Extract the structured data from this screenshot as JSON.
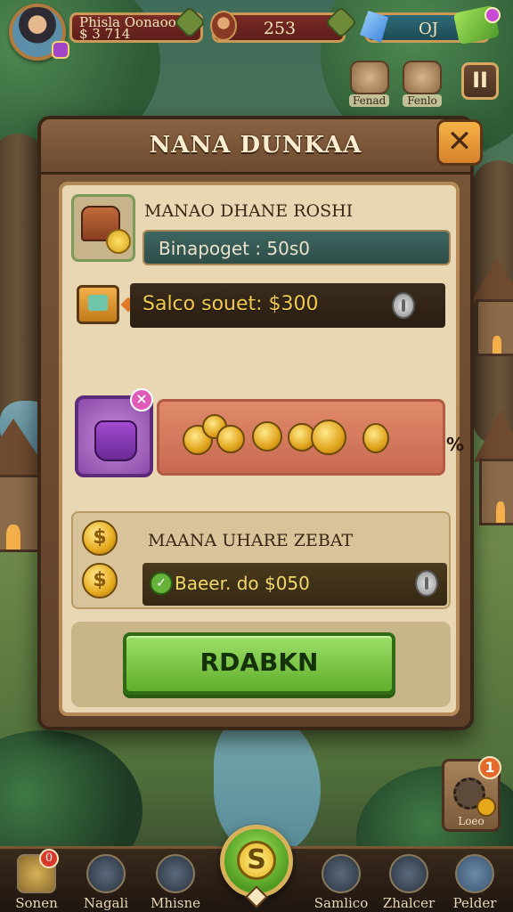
{
  "hud": {
    "player_name": "Phisla Oonaoo",
    "player_sub": "$ 3 714",
    "coins": "253",
    "gems": "OJ"
  },
  "side_top": {
    "item1_label": "Fenad",
    "item2_label": "Fenlo"
  },
  "pause_label": "II",
  "modal": {
    "title": "NANA DUNKAA",
    "close_label": "✕",
    "section1": {
      "title": "MANAO DHANE ROSHI",
      "bar_text": "Binapoget  :  50s0"
    },
    "section2": {
      "bar_text": "Salco souet: $300"
    },
    "section3": {
      "tag": "×",
      "coin_label": "%"
    },
    "section4": {
      "coin_symbol": "$",
      "title": "MAANA UHARE ZEBAT",
      "check": "✓",
      "bar_text": "Baeer.  do $050"
    },
    "claim_button": "RDABKN"
  },
  "side_card": {
    "label": "Loeo",
    "badge": "1"
  },
  "bottom_nav": {
    "items": [
      {
        "label": "Sonen",
        "badge": "0"
      },
      {
        "label": "Nagali"
      },
      {
        "label": "Mhisne"
      },
      {
        "label": "Samlico"
      },
      {
        "label": "Zhalcer"
      },
      {
        "label": "Pelder"
      }
    ],
    "center_symbol": "S"
  },
  "colors": {
    "modal_bg": "#7a5638",
    "panel_bg": "#e9d7b4",
    "claim_green": "#5fae2c",
    "accent_gold": "#e6a91e"
  }
}
